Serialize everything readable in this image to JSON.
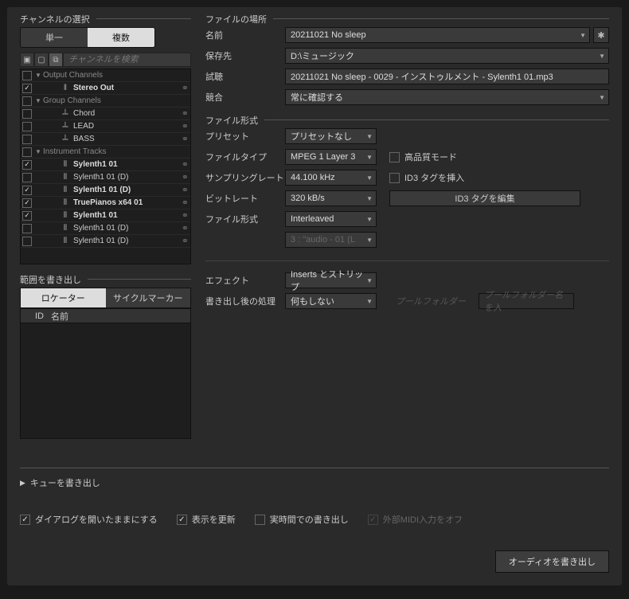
{
  "channel_select": {
    "title": "チャンネルの選択",
    "tab_single": "単一",
    "tab_multiple": "複数",
    "search_placeholder": "チャンネルを検索",
    "groups": [
      {
        "label": "Output Channels",
        "type": "group",
        "checked": false
      },
      {
        "label": "Stereo Out",
        "type": "track",
        "icon": "‖",
        "checked": true,
        "bold": true,
        "indent": 2
      },
      {
        "label": "Group Channels",
        "type": "group",
        "checked": false
      },
      {
        "label": "Chord",
        "type": "track",
        "icon": "𝍦",
        "checked": false,
        "indent": 2
      },
      {
        "label": "LEAD",
        "type": "track",
        "icon": "𝍦",
        "checked": false,
        "indent": 2
      },
      {
        "label": "BASS",
        "type": "track",
        "icon": "𝍦",
        "checked": false,
        "indent": 2
      },
      {
        "label": "Instrument Tracks",
        "type": "group",
        "checked": false
      },
      {
        "label": "Sylenth1 01",
        "type": "track",
        "icon": "⦀",
        "checked": true,
        "bold": true,
        "indent": 2
      },
      {
        "label": "Sylenth1 01 (D)",
        "type": "track",
        "icon": "⦀",
        "checked": false,
        "indent": 2
      },
      {
        "label": "Sylenth1 01 (D)",
        "type": "track",
        "icon": "⦀",
        "checked": true,
        "bold": true,
        "indent": 2
      },
      {
        "label": "TruePianos x64 01",
        "type": "track",
        "icon": "⦀",
        "checked": true,
        "bold": true,
        "indent": 2
      },
      {
        "label": "Sylenth1 01",
        "type": "track",
        "icon": "⦀",
        "checked": true,
        "bold": true,
        "indent": 2
      },
      {
        "label": "Sylenth1 01 (D)",
        "type": "track",
        "icon": "⦀",
        "checked": false,
        "indent": 2
      },
      {
        "label": "Sylenth1 01 (D)",
        "type": "track",
        "icon": "⦀",
        "checked": false,
        "indent": 2
      }
    ]
  },
  "range_export": {
    "title": "範囲を書き出し",
    "tab_locator": "ロケーター",
    "tab_cycle": "サイクルマーカー",
    "col_id": "ID",
    "col_name": "名前"
  },
  "file_location": {
    "title": "ファイルの場所",
    "name_label": "名前",
    "name_value": "20211021 No sleep",
    "save_label": "保存先",
    "save_value": "D:\\ミュージック",
    "preview_label": "試聴",
    "preview_value": "20211021 No sleep - 0029 - インストゥルメント - Sylenth1 01.mp3",
    "conflict_label": "競合",
    "conflict_value": "常に確認する"
  },
  "file_format": {
    "title": "ファイル形式",
    "preset_label": "プリセット",
    "preset_value": "プリセットなし",
    "filetype_label": "ファイルタイプ",
    "filetype_value": "MPEG 1 Layer 3",
    "hq_label": "高品質モード",
    "samplerate_label": "サンプリングレート",
    "samplerate_value": "44.100 kHz",
    "id3_insert_label": "ID3 タグを挿入",
    "bitrate_label": "ビットレート",
    "bitrate_value": "320 kB/s",
    "id3_edit_label": "ID3 タグを編集",
    "fileformat_label": "ファイル形式",
    "fileformat_value": "Interleaved",
    "audio_ext_value": "3 : \"audio - 01 (L"
  },
  "effects": {
    "effect_label": "エフェクト",
    "effect_value": "Inserts とストリップ",
    "post_label": "書き出し後の処理",
    "post_value": "何もしない",
    "pool_folder_label": "プールフォルダー",
    "pool_folder_input": "プールフォルダー名を入"
  },
  "queue": {
    "title": "キューを書き出し"
  },
  "bottom": {
    "keep_dialog": "ダイアログを開いたままにする",
    "update_display": "表示を更新",
    "realtime": "実時間での書き出し",
    "ext_midi": "外部MIDI入力をオフ",
    "export_button": "オーディオを書き出し"
  }
}
